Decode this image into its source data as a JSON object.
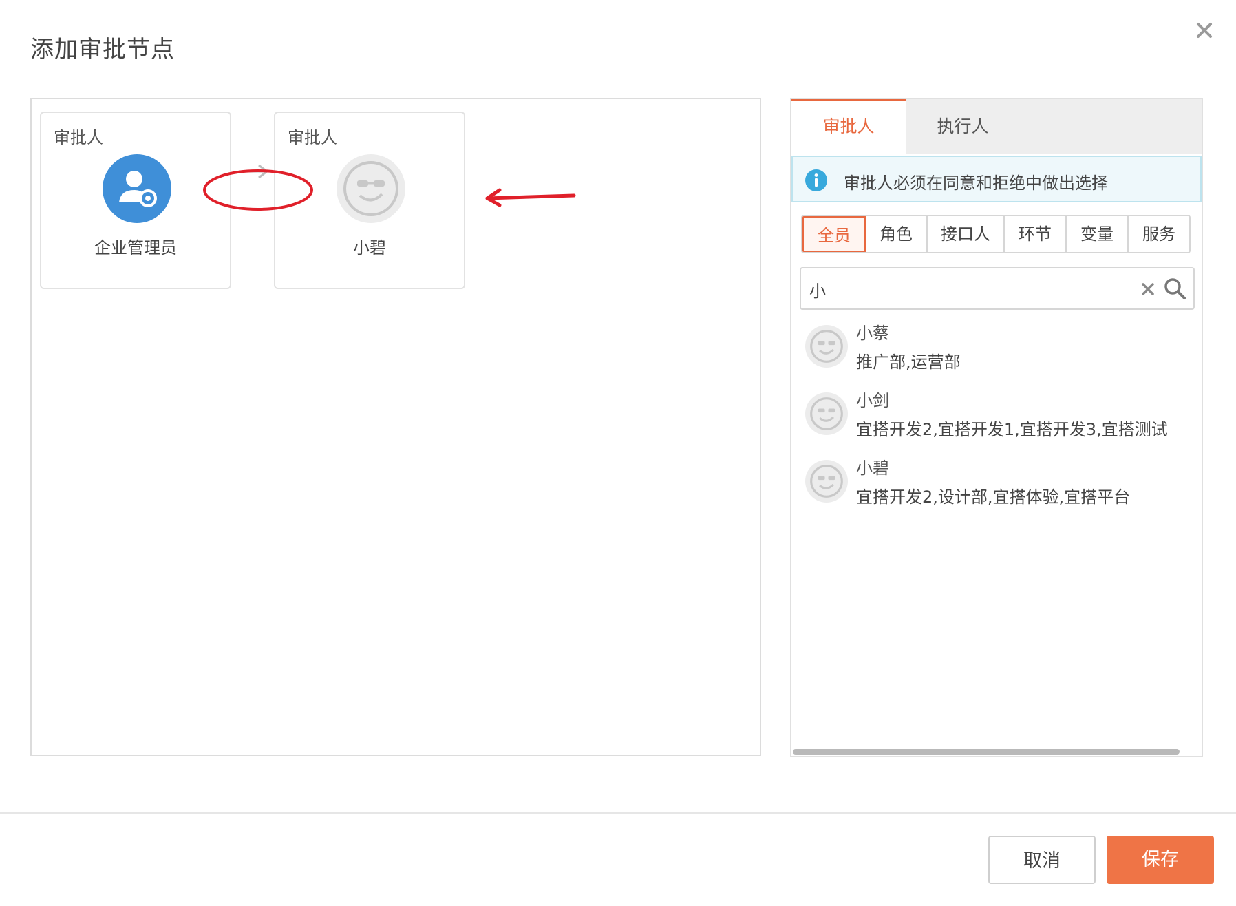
{
  "dialog": {
    "title": "添加审批节点",
    "close_icon": "close-icon"
  },
  "flow": {
    "nodes": [
      {
        "label": "审批人",
        "name": "企业管理员",
        "avatar": "admin-gear-icon"
      },
      {
        "label": "审批人",
        "name": "小碧",
        "avatar": "default-face-avatar-icon"
      }
    ],
    "connector_icon": "arrow-right-icon"
  },
  "picker": {
    "tabs": [
      {
        "label": "审批人",
        "active": true
      },
      {
        "label": "执行人",
        "active": false
      }
    ],
    "notice": "审批人必须在同意和拒绝中做出选择",
    "filters": [
      {
        "label": "全员",
        "active": true
      },
      {
        "label": "角色",
        "active": false
      },
      {
        "label": "接口人",
        "active": false
      },
      {
        "label": "环节",
        "active": false
      },
      {
        "label": "变量",
        "active": false
      },
      {
        "label": "服务",
        "active": false
      }
    ],
    "search": {
      "value": "小",
      "placeholder": ""
    },
    "results": [
      {
        "name": "小蔡",
        "dept": "推广部,运营部"
      },
      {
        "name": "小剑",
        "dept": "宜搭开发2,宜搭开发1,宜搭开发3,宜搭测试"
      },
      {
        "name": "小碧",
        "dept": "宜搭开发2,设计部,宜搭体验,宜搭平台"
      }
    ]
  },
  "footer": {
    "cancel_label": "取消",
    "save_label": "保存"
  },
  "colors": {
    "accent": "#ef7446",
    "admin_avatar": "#3f8fd8",
    "annotation_red": "#e0202a",
    "info_blue": "#38a9dc"
  }
}
